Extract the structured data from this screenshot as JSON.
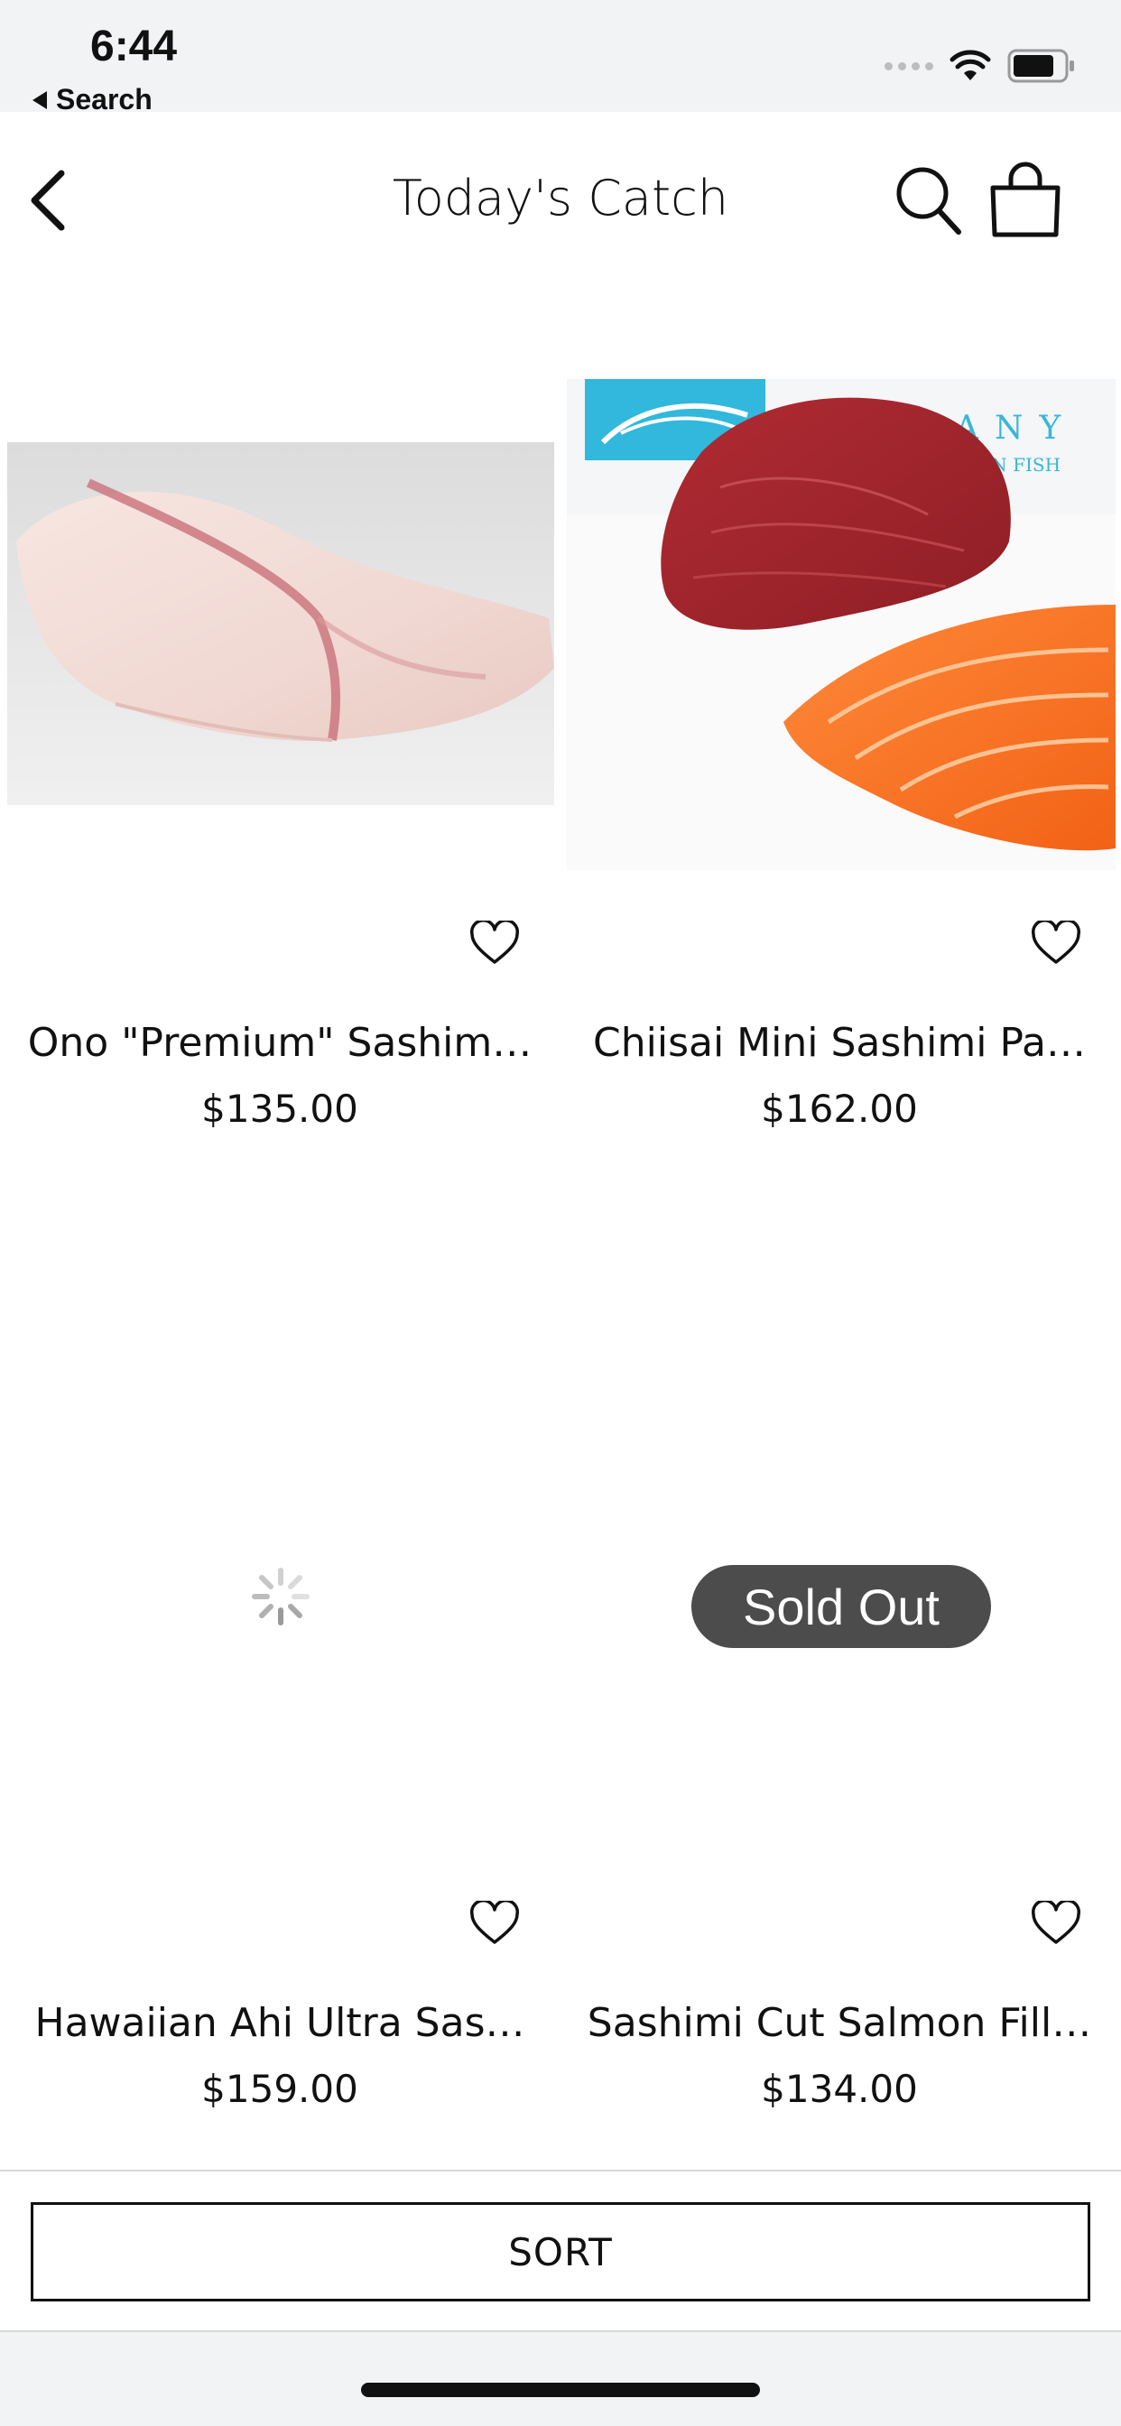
{
  "status_bar": {
    "time": "6:44",
    "back_app_label": "Search"
  },
  "header": {
    "title": "Today's Catch",
    "back_icon": "chevron-left-icon",
    "search_icon": "search-icon",
    "cart_icon": "shopping-bag-icon"
  },
  "products": [
    {
      "name": "Ono \"Premium\" Sashim…",
      "price": "$135.00",
      "image": "white fish loin",
      "favorite": false
    },
    {
      "name": "Chiisai Mini Sashimi Pa…",
      "price": "$162.00",
      "image": "ahi tuna and salmon fillet",
      "favorite": false
    },
    {
      "name": "Hawaiian Ahi Ultra Sas…",
      "price": "$159.00",
      "image": "loading",
      "favorite": false
    },
    {
      "name": "Sashimi Cut Salmon Fill…",
      "price": "$134.00",
      "image": "loading",
      "badge": "Sold Out",
      "favorite": false
    }
  ],
  "sort": {
    "label": "SORT"
  },
  "colors": {
    "background": "#f2f3f5",
    "surface": "#ffffff",
    "text": "#111111",
    "badge": "#4c4c4c"
  }
}
